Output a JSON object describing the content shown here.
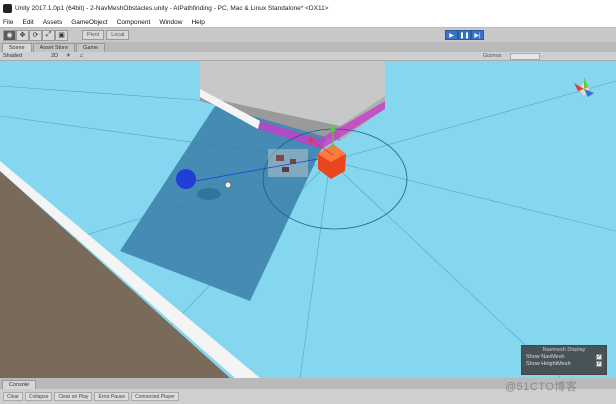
{
  "window": {
    "title": "Unity 2017.1.0p1 (64bit) - 2-NavMeshObstacles.unity - AIPathfinding - PC, Mac & Linux Standalone* <DX11>"
  },
  "menubar": [
    "File",
    "Edit",
    "Assets",
    "GameObject",
    "Component",
    "Window",
    "Help"
  ],
  "toolbar": {
    "tools": [
      "hand-icon",
      "move-icon",
      "rotate-icon",
      "scale-icon",
      "rect-icon"
    ],
    "pivot_label": "Pivot",
    "local_label": "Local",
    "play_controls": [
      "play-icon",
      "pause-icon",
      "step-icon"
    ],
    "play_color": "#3a72c8"
  },
  "tabs": [
    "Scene",
    "Asset Store",
    "Game"
  ],
  "scene_toolbar": {
    "shading_mode": "Shaded",
    "view_2d": "2D",
    "gizmos_label": "Gizmos"
  },
  "scene": {
    "floor_color": "#84d7ef",
    "plane_label_colors": {
      "cube": "#e8461c",
      "sphere": "#1f3fd6",
      "navmesh": "#c83cc8"
    }
  },
  "navmesh_display": {
    "title": "Navmesh Display",
    "show_navmesh_label": "Show NavMesh",
    "show_navmesh_checked": true,
    "show_heightmesh_label": "Show HeightMesh",
    "show_heightmesh_checked": true
  },
  "console": {
    "tab_label": "Console",
    "buttons": [
      "Clear",
      "Collapse",
      "Clear on Play",
      "Error Pause",
      "Connected Player"
    ]
  },
  "watermark": "@51CTO博客"
}
